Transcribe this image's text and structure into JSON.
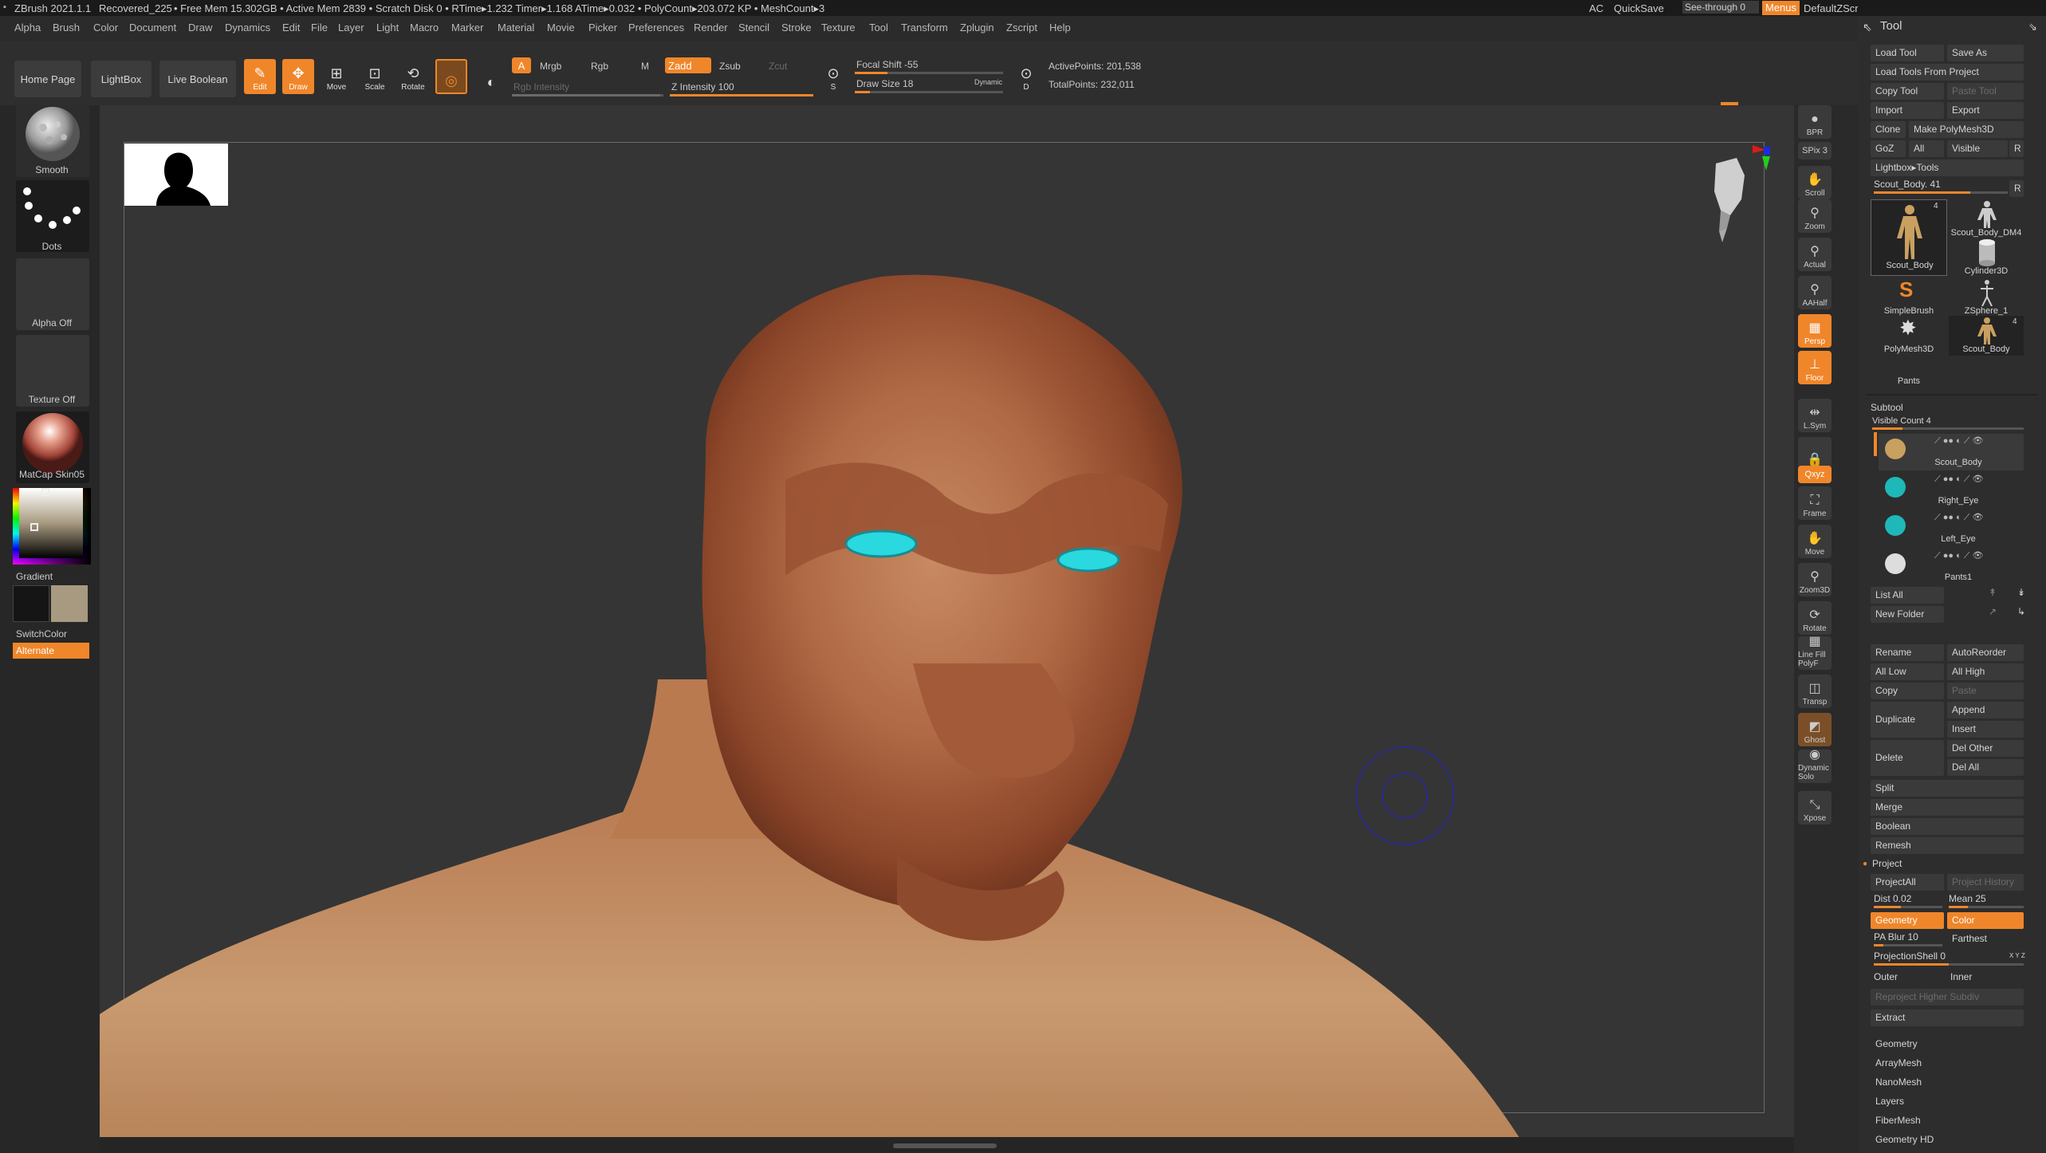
{
  "titlebar": {
    "app": "ZBrush 2021.1.1",
    "doc": "Recovered_225",
    "stats": "• Free Mem 15.302GB • Active Mem 2839 • Scratch Disk 0 • RTime▸1.232 Timer▸1.168 ATime▸0.032 • PolyCount▸203.072 KP • MeshCount▸3",
    "ac": "AC",
    "quicksave": "QuickSave",
    "see_through": "See-through  0",
    "menus": "Menus",
    "script": "DefaultZScript"
  },
  "menubar": [
    "Alpha",
    "Brush",
    "Color",
    "Document",
    "Draw",
    "Dynamics",
    "Edit",
    "File",
    "Layer",
    "Light",
    "Macro",
    "Marker",
    "Material",
    "Movie",
    "Picker",
    "Preferences",
    "Render",
    "Stencil",
    "Stroke",
    "Texture",
    "Tool",
    "Transform",
    "Zplugin",
    "Zscript",
    "Help"
  ],
  "toolbar": {
    "home_page": "Home Page",
    "lightbox": "LightBox",
    "live_boolean": "Live Boolean",
    "edit": "Edit",
    "draw": "Draw",
    "move": "Move",
    "scale": "Scale",
    "rotate": "Rotate",
    "a": "A",
    "mrgb": "Mrgb",
    "rgb": "Rgb",
    "m": "M",
    "zadd": "Zadd",
    "zsub": "Zsub",
    "zcut": "Zcut",
    "rgb_intensity": "Rgb Intensity",
    "z_intensity": "Z Intensity 100",
    "focal_shift": "Focal Shift -55",
    "draw_size": "Draw Size 18",
    "dynamic": "Dynamic",
    "active_points": "ActivePoints: 201,538",
    "total_points": "TotalPoints: 232,011",
    "s_label": "S",
    "d_label": "D"
  },
  "left_shelf": {
    "brush": "Smooth",
    "stroke": "Dots",
    "alpha": "Alpha Off",
    "texture": "Texture Off",
    "material": "MatCap Skin05",
    "gradient": "Gradient",
    "switch_color": "SwitchColor",
    "alternate": "Alternate",
    "colors": {
      "main": "#151515",
      "secondary": "#a89a80"
    }
  },
  "right_shelf": [
    {
      "name": "BPR",
      "icon": "sphere-icon"
    },
    {
      "name": "SPix 3",
      "icon": ""
    },
    {
      "name": "Scroll",
      "icon": "hand-icon"
    },
    {
      "name": "Zoom",
      "icon": "magnifier-icon"
    },
    {
      "name": "Actual",
      "icon": "magnifier-icon"
    },
    {
      "name": "AAHalf",
      "icon": "magnifier-icon"
    },
    {
      "name": "Persp",
      "icon": "grid-icon"
    },
    {
      "name": "Floor",
      "icon": "floor-icon"
    },
    {
      "name": "L.Sym",
      "icon": "symmetry-icon"
    },
    {
      "name": "",
      "icon": "lock-icon"
    },
    {
      "name": "Qxyz",
      "icon": ""
    },
    {
      "name": "Frame",
      "icon": "frame-icon"
    },
    {
      "name": "Move",
      "icon": "hand-icon"
    },
    {
      "name": "Zoom3D",
      "icon": "magnifier-icon"
    },
    {
      "name": "Rotate",
      "icon": "rotate-icon"
    },
    {
      "name": "Line Fill PolyF",
      "icon": "grid-icon"
    },
    {
      "name": "Transp",
      "icon": "transparency-icon"
    },
    {
      "name": "Ghost",
      "icon": "ghost-icon"
    },
    {
      "name": "Dynamic Solo",
      "icon": "solo-icon"
    },
    {
      "name": "Xpose",
      "icon": "xpose-icon"
    }
  ],
  "tool_panel": {
    "title": "Tool",
    "load_tool": "Load Tool",
    "save_as": "Save As",
    "load_from_project": "Load Tools From Project",
    "copy_tool": "Copy Tool",
    "paste_tool": "Paste Tool",
    "import": "Import",
    "export": "Export",
    "clone": "Clone",
    "make_polymesh": "Make PolyMesh3D",
    "goz": "GoZ",
    "all": "All",
    "visible": "Visible",
    "r": "R",
    "lightbox_tools": "Lightbox▸Tools",
    "current_tool": "Scout_Body. 41",
    "tools": [
      {
        "name": "Scout_Body",
        "count": "4"
      },
      {
        "name": "Scout_Body_DM4",
        "count": ""
      },
      {
        "name": "Cylinder3D",
        "count": ""
      },
      {
        "name": "SimpleBrush",
        "count": ""
      },
      {
        "name": "ZSphere_1",
        "count": ""
      },
      {
        "name": "PolyMesh3D",
        "count": ""
      },
      {
        "name": "Scout_Body",
        "count": "4"
      }
    ],
    "pants": "Pants"
  },
  "subtool": {
    "title": "Subtool",
    "visible_count": "Visible Count 4",
    "items": [
      "Scout_Body",
      "Right_Eye",
      "Left_Eye",
      "Pants1"
    ],
    "list_all": "List All",
    "new_folder": "New Folder",
    "rename": "Rename",
    "auto_reorder": "AutoReorder",
    "all_low": "All Low",
    "all_high": "All High",
    "copy": "Copy",
    "paste": "Paste",
    "duplicate": "Duplicate",
    "append": "Append",
    "insert": "Insert",
    "delete": "Delete",
    "del_other": "Del Other",
    "del_all": "Del All",
    "split": "Split",
    "merge": "Merge",
    "boolean": "Boolean",
    "remesh": "Remesh",
    "project": "Project",
    "project_all": "ProjectAll",
    "project_history": "Project History",
    "dist": "Dist 0.02",
    "mean": "Mean 25",
    "geometry_btn": "Geometry",
    "color_btn": "Color",
    "pa_blur": "PA Blur 10",
    "farthest": "Farthest",
    "projection_shell": "ProjectionShell 0",
    "xyz": "X Y Z",
    "outer": "Outer",
    "inner": "Inner",
    "reproject": "Reproject Higher Subdiv",
    "extract": "Extract"
  },
  "sections": [
    "Geometry",
    "ArrayMesh",
    "NanoMesh",
    "Layers",
    "FiberMesh",
    "Geometry HD"
  ],
  "accent": "#f0862a"
}
